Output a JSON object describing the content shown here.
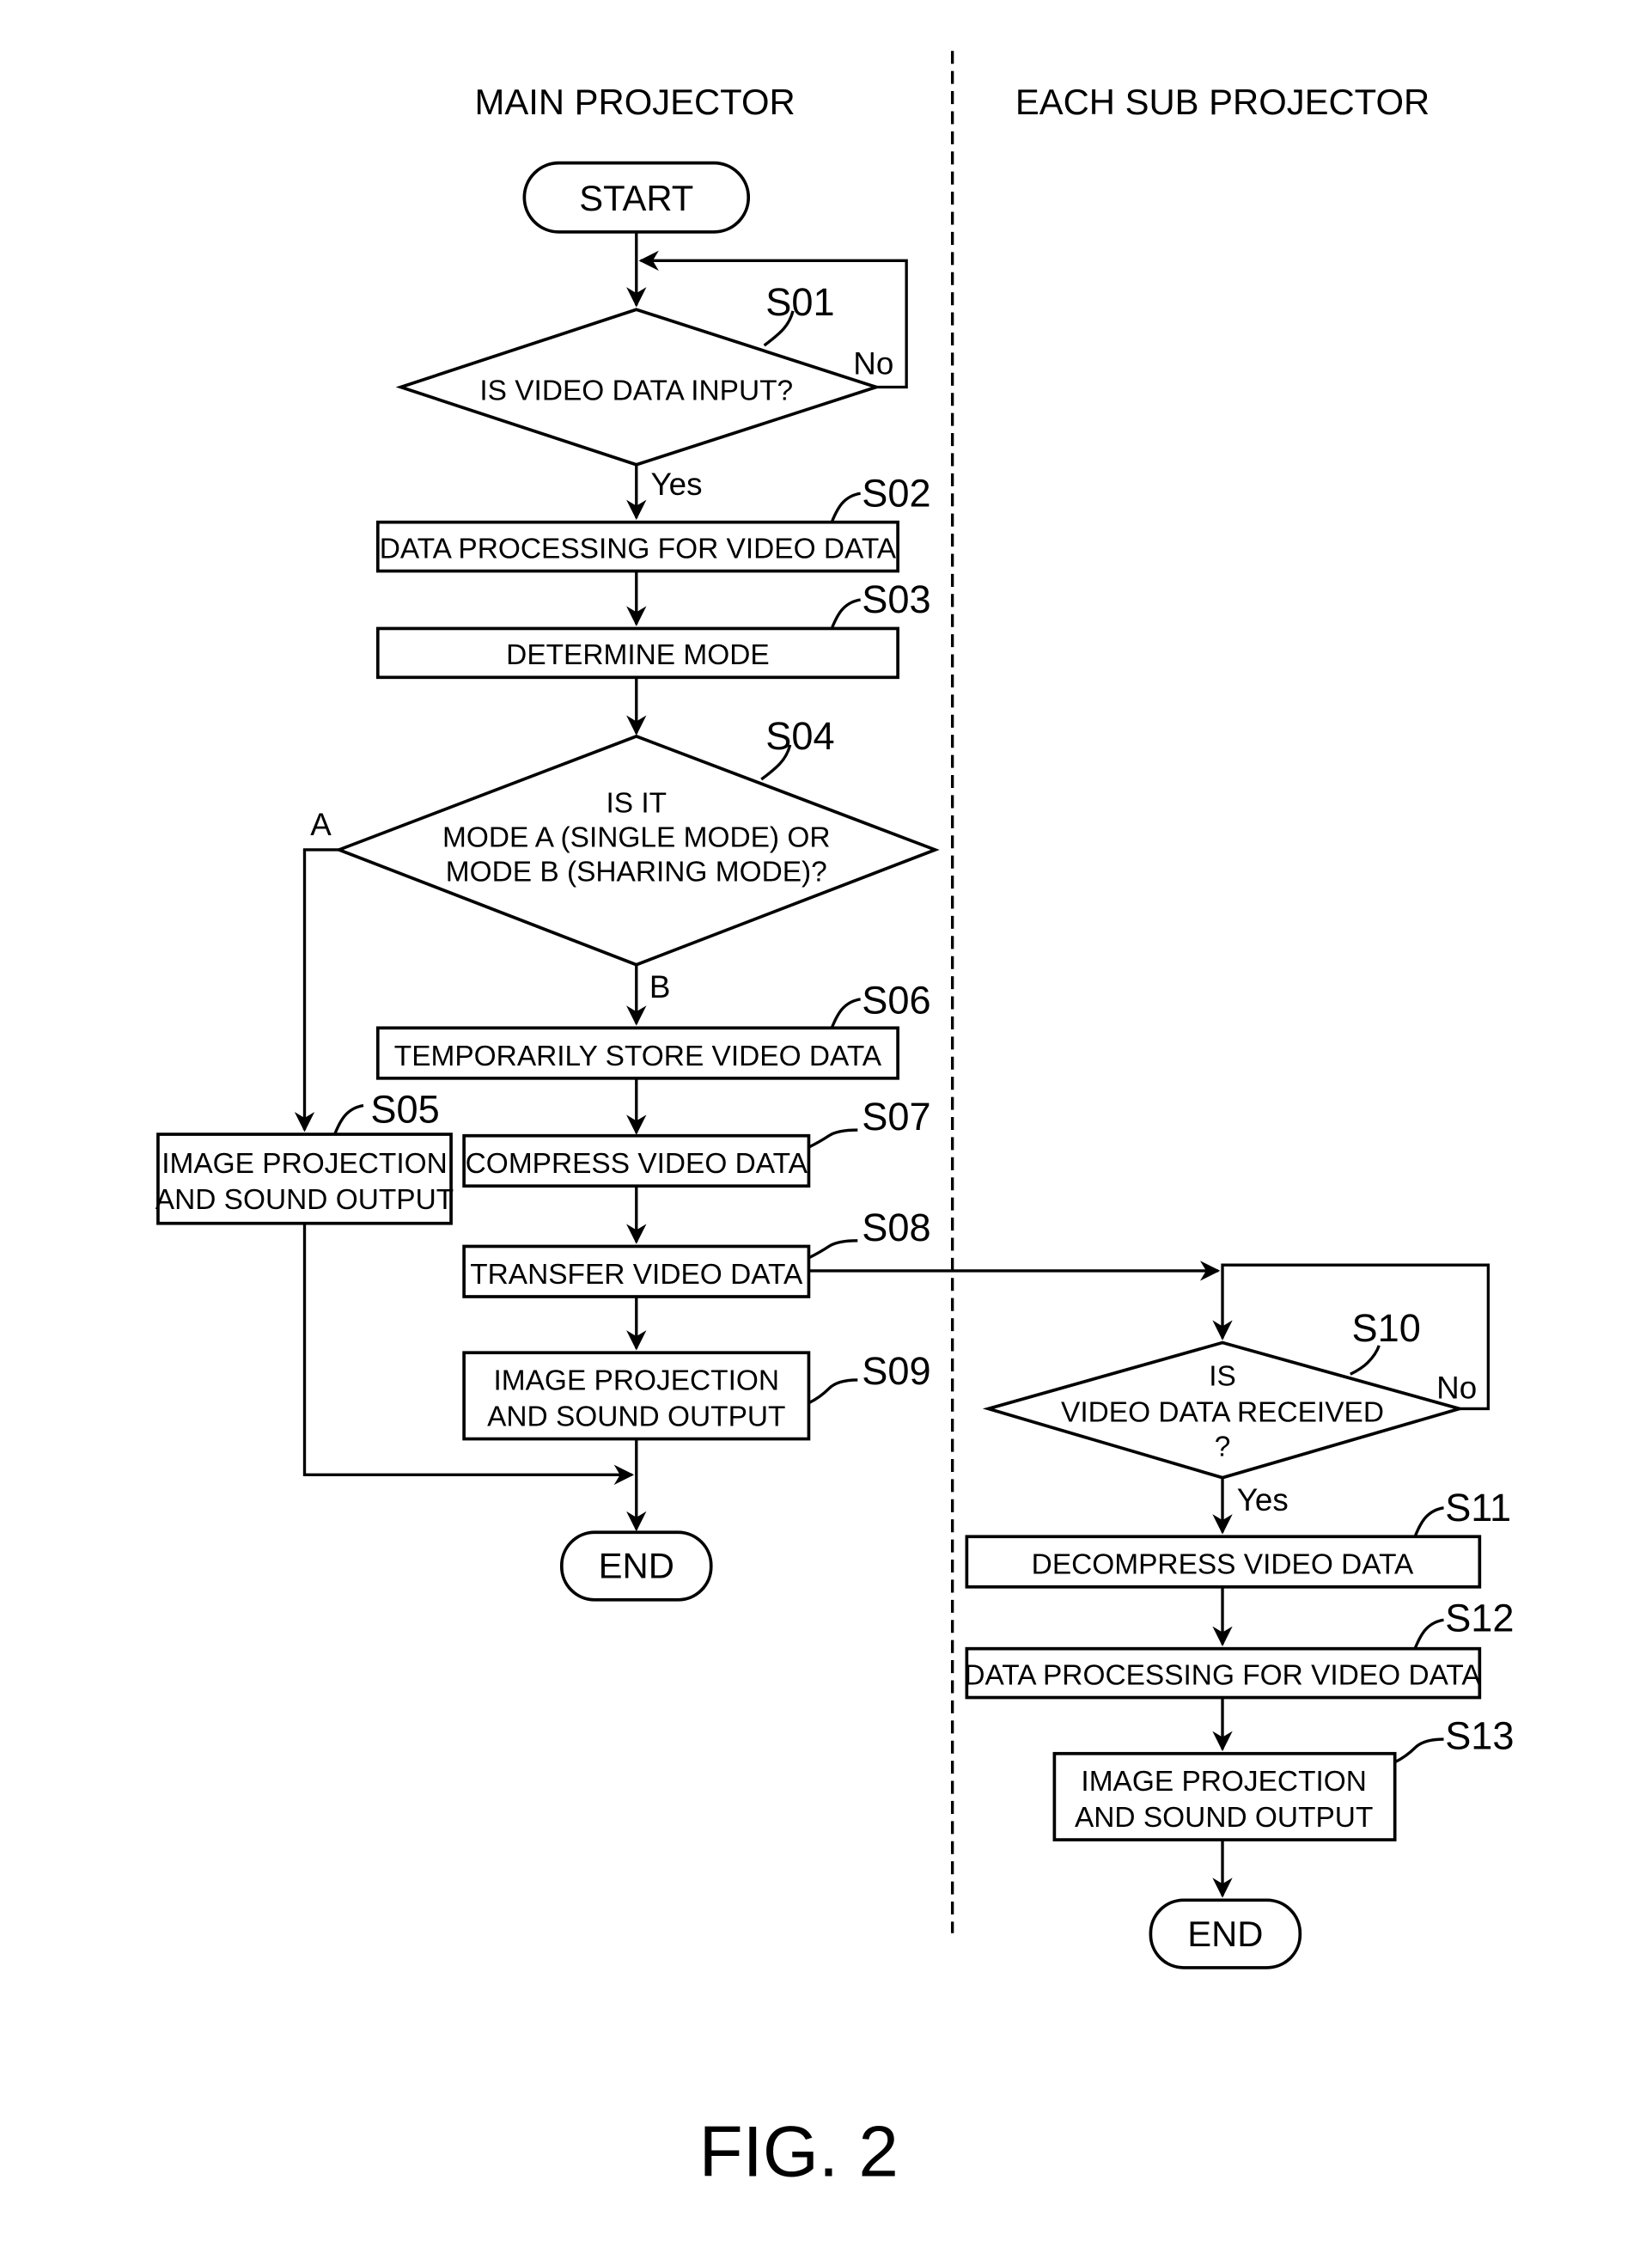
{
  "lanes": {
    "main": "MAIN PROJECTOR",
    "sub": "EACH SUB PROJECTOR"
  },
  "terminals": {
    "start": "START",
    "end_main": "END",
    "end_sub": "END"
  },
  "steps": {
    "S01": {
      "id": "S01",
      "type": "decision",
      "lines": [
        "IS VIDEO DATA INPUT?"
      ]
    },
    "S02": {
      "id": "S02",
      "type": "process",
      "lines": [
        "DATA PROCESSING FOR VIDEO DATA"
      ]
    },
    "S03": {
      "id": "S03",
      "type": "process",
      "lines": [
        "DETERMINE MODE"
      ]
    },
    "S04": {
      "id": "S04",
      "type": "decision",
      "lines": [
        "IS IT",
        "MODE A (SINGLE MODE) OR",
        "MODE B (SHARING MODE)?"
      ]
    },
    "S05": {
      "id": "S05",
      "type": "process",
      "lines": [
        "IMAGE PROJECTION",
        "AND SOUND OUTPUT"
      ]
    },
    "S06": {
      "id": "S06",
      "type": "process",
      "lines": [
        "TEMPORARILY STORE VIDEO DATA"
      ]
    },
    "S07": {
      "id": "S07",
      "type": "process",
      "lines": [
        "COMPRESS VIDEO DATA"
      ]
    },
    "S08": {
      "id": "S08",
      "type": "process",
      "lines": [
        "TRANSFER VIDEO DATA"
      ]
    },
    "S09": {
      "id": "S09",
      "type": "process",
      "lines": [
        "IMAGE PROJECTION",
        "AND SOUND OUTPUT"
      ]
    },
    "S10": {
      "id": "S10",
      "type": "decision",
      "lines": [
        "IS",
        "VIDEO DATA RECEIVED",
        "?"
      ]
    },
    "S11": {
      "id": "S11",
      "type": "process",
      "lines": [
        "DECOMPRESS VIDEO DATA"
      ]
    },
    "S12": {
      "id": "S12",
      "type": "process",
      "lines": [
        "DATA PROCESSING FOR VIDEO DATA"
      ]
    },
    "S13": {
      "id": "S13",
      "type": "process",
      "lines": [
        "IMAGE PROJECTION",
        "AND SOUND OUTPUT"
      ]
    }
  },
  "branch_labels": {
    "s01_no": "No",
    "s01_yes": "Yes",
    "s04_a": "A",
    "s04_b": "B",
    "s10_no": "No",
    "s10_yes": "Yes"
  },
  "caption": "FIG. 2"
}
